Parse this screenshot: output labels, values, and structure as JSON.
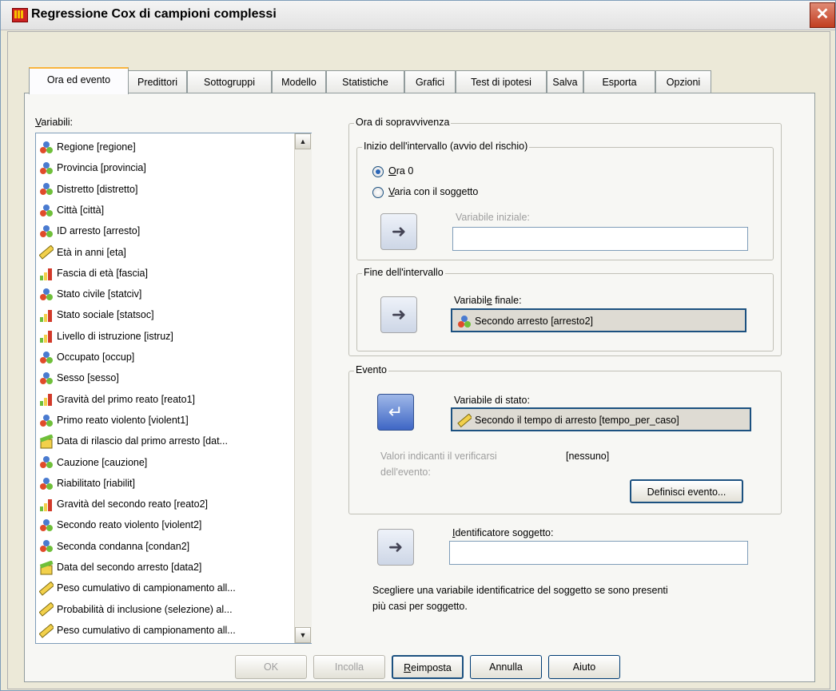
{
  "window": {
    "title": "Regressione Cox di campioni complessi",
    "close_glyph": "✕"
  },
  "tabs": [
    {
      "label": "Ora ed evento",
      "active": true
    },
    {
      "label": "Predittori"
    },
    {
      "label": "Sottogruppi"
    },
    {
      "label": "Modello"
    },
    {
      "label": "Statistiche"
    },
    {
      "label": "Grafici"
    },
    {
      "label": "Test di ipotesi"
    },
    {
      "label": "Salva"
    },
    {
      "label": "Esporta"
    },
    {
      "label": "Opzioni"
    }
  ],
  "variables": {
    "label": "Variabili:",
    "items": [
      {
        "label": "Regione [regione]",
        "icon": "nominal"
      },
      {
        "label": "Provincia [provincia]",
        "icon": "nominal"
      },
      {
        "label": "Distretto [distretto]",
        "icon": "nominal"
      },
      {
        "label": "Città [città]",
        "icon": "nominal"
      },
      {
        "label": "ID arresto [arresto]",
        "icon": "nominal"
      },
      {
        "label": "Età in anni [eta]",
        "icon": "scale"
      },
      {
        "label": "Fascia di età [fascia]",
        "icon": "ordinal"
      },
      {
        "label": "Stato civile [statciv]",
        "icon": "nominal"
      },
      {
        "label": "Stato sociale [statsoc]",
        "icon": "ordinal"
      },
      {
        "label": "Livello di istruzione [istruz]",
        "icon": "ordinal"
      },
      {
        "label": "Occupato [occup]",
        "icon": "nominal"
      },
      {
        "label": "Sesso [sesso]",
        "icon": "nominal"
      },
      {
        "label": "Gravità del primo reato [reato1]",
        "icon": "ordinal"
      },
      {
        "label": "Primo reato violento [violent1]",
        "icon": "nominal"
      },
      {
        "label": "Data di rilascio dal primo arresto [dat...",
        "icon": "date"
      },
      {
        "label": "Cauzione [cauzione]",
        "icon": "nominal"
      },
      {
        "label": "Riabilitato [riabilit]",
        "icon": "nominal"
      },
      {
        "label": "Gravità del secondo reato [reato2]",
        "icon": "ordinal"
      },
      {
        "label": "Secondo reato violento [violent2]",
        "icon": "nominal"
      },
      {
        "label": "Seconda condanna [condan2]",
        "icon": "nominal"
      },
      {
        "label": "Data del secondo arresto [data2]",
        "icon": "date"
      },
      {
        "label": "Peso cumulativo di campionamento all...",
        "icon": "scale"
      },
      {
        "label": "Probabilità di inclusione (selezione) al...",
        "icon": "scale"
      },
      {
        "label": "Peso cumulativo di campionamento all...",
        "icon": "scale"
      }
    ]
  },
  "survival": {
    "title": "Ora di sopravvivenza",
    "start": {
      "title": "Inizio dell'intervallo (avvio del rischio)",
      "option1": "Ora 0",
      "option2": "Varia con il soggetto",
      "field_label": "Variabile iniziale:",
      "field_value": ""
    },
    "end": {
      "title": "Fine dell'intervallo",
      "field_label": "Variabile finale:",
      "field_value": "Secondo arresto [arresto2]"
    }
  },
  "event": {
    "title": "Evento",
    "field_label": "Variabile di stato:",
    "field_value": "Secondo il tempo di arresto [tempo_per_caso]",
    "values_label_1": "Valori indicanti il verificarsi",
    "values_label_2": "dell'evento:",
    "values_value": "[nessuno]",
    "define_button": "Definisci evento..."
  },
  "subject": {
    "field_label": "Identificatore soggetto:",
    "field_value": "",
    "hint_1": "Scegliere una variabile identificatrice del soggetto se sono presenti",
    "hint_2": "più casi per soggetto."
  },
  "buttons": {
    "ok": "OK",
    "paste": "Incolla",
    "reset": "Reimposta",
    "cancel": "Annulla",
    "help": "Aiuto"
  },
  "colors": {
    "accent": "#2a66b8",
    "tab_highlight": "#f9b43e"
  }
}
